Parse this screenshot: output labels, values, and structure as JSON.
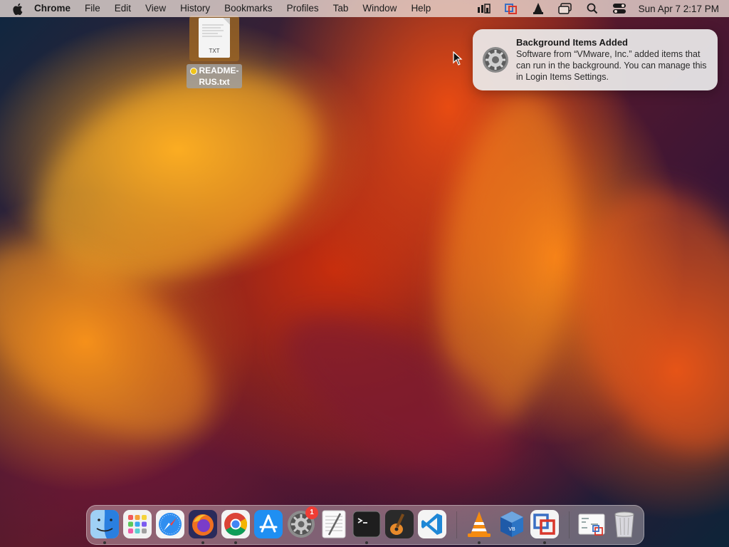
{
  "menubar": {
    "app_name": "Chrome",
    "items": [
      "File",
      "Edit",
      "View",
      "History",
      "Bookmarks",
      "Profiles",
      "Tab",
      "Window",
      "Help"
    ],
    "clock": "Sun Apr 7  2:17 PM",
    "status_icons": [
      "status-bar-stats-icon",
      "vmware-fusion-icon",
      "vlc-icon",
      "screen-mirroring-icon",
      "spotlight-search-icon",
      "control-center-icon"
    ]
  },
  "desktop_file": {
    "name": "README-RUS.txt",
    "type_label": "TXT",
    "tag_color": "#f0c419"
  },
  "notification": {
    "title": "Background Items Added",
    "body": "Software from “VMware, Inc.” added items that can run in the background. You can manage this in Login Items Settings.",
    "icon": "system-settings-gear-icon"
  },
  "dock": {
    "apps": [
      {
        "name": "Finder",
        "icon": "finder-icon",
        "running": true
      },
      {
        "name": "Launchpad",
        "icon": "launchpad-icon",
        "running": false
      },
      {
        "name": "Safari",
        "icon": "safari-icon",
        "running": false
      },
      {
        "name": "Firefox",
        "icon": "firefox-icon",
        "running": true
      },
      {
        "name": "Google Chrome",
        "icon": "chrome-icon",
        "running": true
      },
      {
        "name": "App Store",
        "icon": "app-store-icon",
        "running": false
      },
      {
        "name": "System Settings",
        "icon": "system-settings-icon",
        "running": false,
        "badge": "1"
      },
      {
        "name": "TextEdit",
        "icon": "textedit-icon",
        "running": false
      },
      {
        "name": "Terminal",
        "icon": "terminal-icon",
        "running": true
      },
      {
        "name": "GarageBand",
        "icon": "garageband-icon",
        "running": false
      },
      {
        "name": "Visual Studio Code",
        "icon": "vscode-icon",
        "running": false
      },
      {
        "name": "VLC",
        "icon": "vlc-icon",
        "running": true
      },
      {
        "name": "VirtualBox",
        "icon": "virtualbox-icon",
        "running": false
      },
      {
        "name": "VMware Fusion",
        "icon": "vmware-fusion-icon",
        "running": true
      },
      {
        "name": "Downloads stack",
        "icon": "downloads-stack-icon",
        "running": false
      },
      {
        "name": "Trash",
        "icon": "trash-icon",
        "running": false
      }
    ]
  }
}
